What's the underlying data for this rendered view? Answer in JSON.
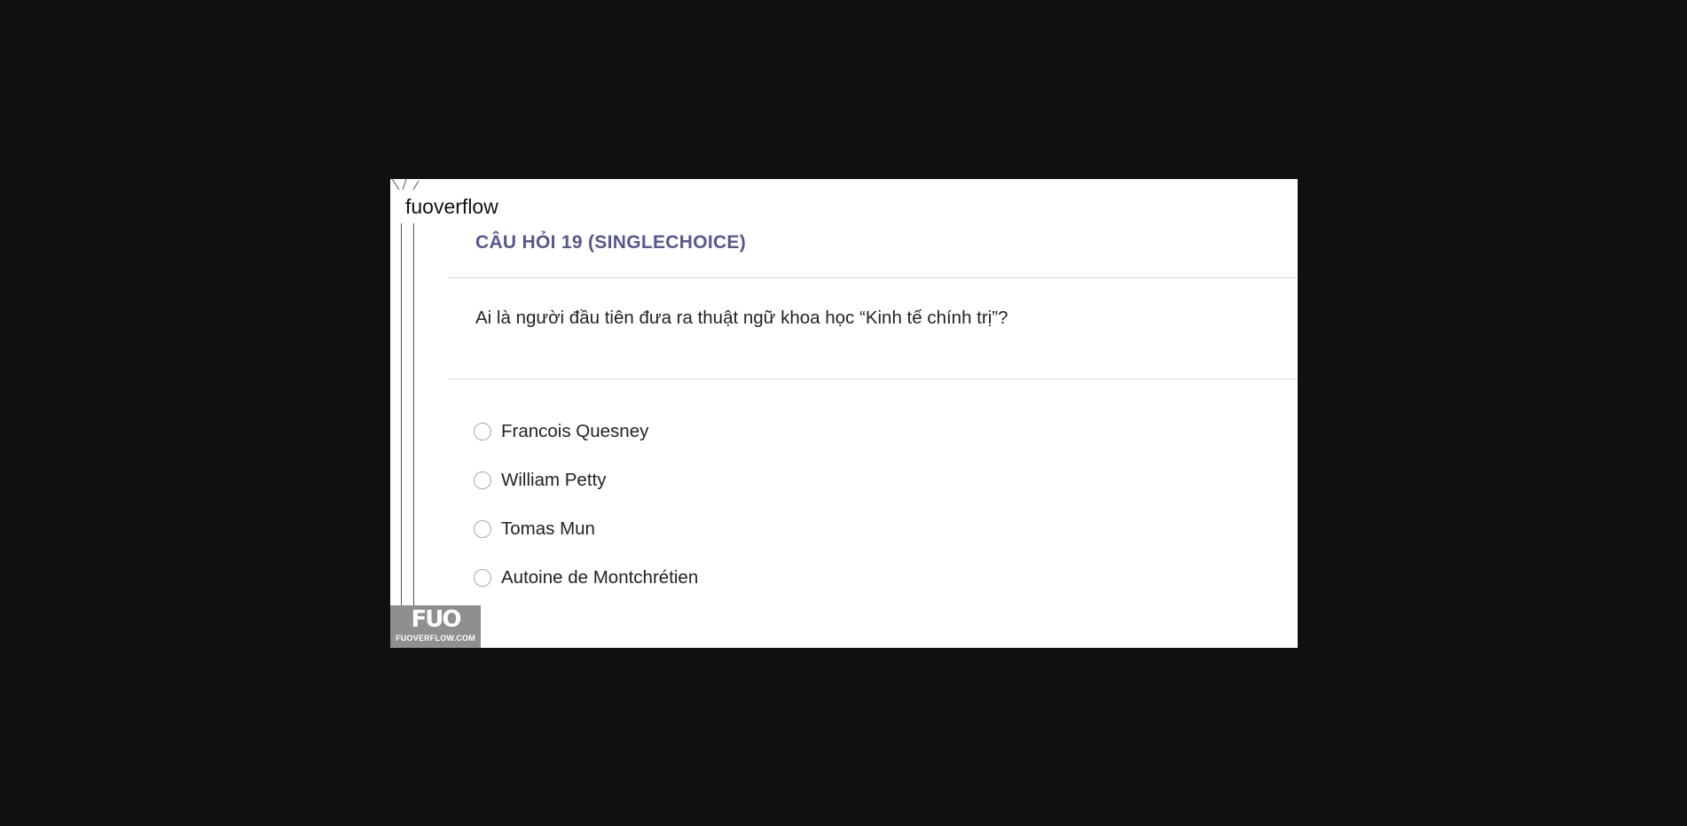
{
  "watermark": {
    "site_name": "fuoverflow",
    "logo_text": "FUO",
    "logo_url": "FUOVERFLOW.COM"
  },
  "question": {
    "header": "CÂU HỎI 19 (SINGLECHOICE)",
    "text": "Ai là người đầu tiên đưa ra thuật ngữ khoa học “Kinh tế chính trị”?",
    "options": [
      {
        "label": "Francois Quesney",
        "selected": false
      },
      {
        "label": "William Petty",
        "selected": false
      },
      {
        "label": "Tomas Mun",
        "selected": false
      },
      {
        "label": "Autoine de Montchrétien",
        "selected": false
      }
    ]
  },
  "colors": {
    "header": "#55588f",
    "backdrop": "#101011",
    "card": "#ffffff"
  }
}
